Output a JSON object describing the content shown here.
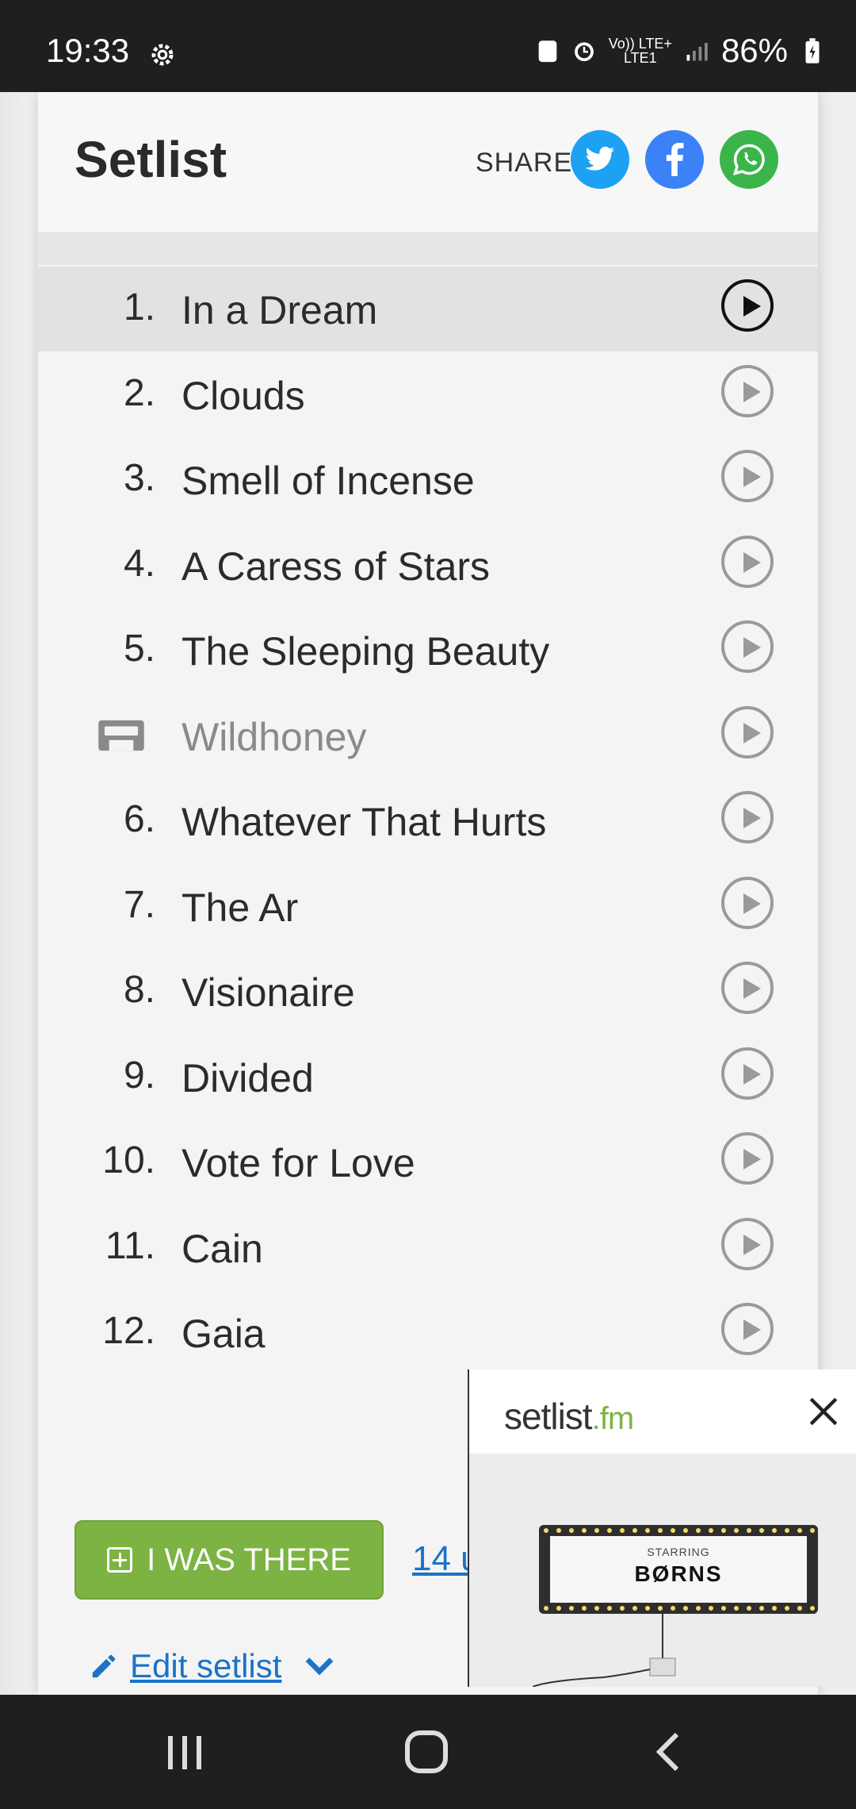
{
  "status_bar": {
    "time": "19:33",
    "network": "Vo)) LTE+",
    "network_sub": "LTE1",
    "battery": "86%"
  },
  "header": {
    "title": "Setlist",
    "share_label": "SHARE"
  },
  "share_buttons": [
    {
      "name": "twitter",
      "color": "#1da1f2"
    },
    {
      "name": "facebook",
      "color": "#3b82f6"
    },
    {
      "name": "whatsapp",
      "color": "#3ab54a"
    }
  ],
  "songs": [
    {
      "num": "1.",
      "title": "In a Dream",
      "active": true
    },
    {
      "num": "2.",
      "title": "Clouds"
    },
    {
      "num": "3.",
      "title": "Smell of Incense"
    },
    {
      "num": "4.",
      "title": "A Caress of Stars"
    },
    {
      "num": "5.",
      "title": "The Sleeping Beauty"
    },
    {
      "num": "",
      "title": "Wildhoney",
      "tape": true
    },
    {
      "num": "6.",
      "title": "Whatever That Hurts"
    },
    {
      "num": "7.",
      "title": "The Ar"
    },
    {
      "num": "8.",
      "title": "Visionaire"
    },
    {
      "num": "9.",
      "title": "Divided"
    },
    {
      "num": "10.",
      "title": "Vote for Love"
    },
    {
      "num": "11.",
      "title": "Cain"
    },
    {
      "num": "12.",
      "title": "Gaia"
    }
  ],
  "actions": {
    "was_there": "I WAS THERE",
    "users_link": "14 u",
    "edit_setlist": "Edit setlist"
  },
  "ad": {
    "logo_main": "setlist",
    "logo_suffix": ".fm",
    "marquee_sub": "STARRING",
    "marquee_main": "BØRNS"
  }
}
